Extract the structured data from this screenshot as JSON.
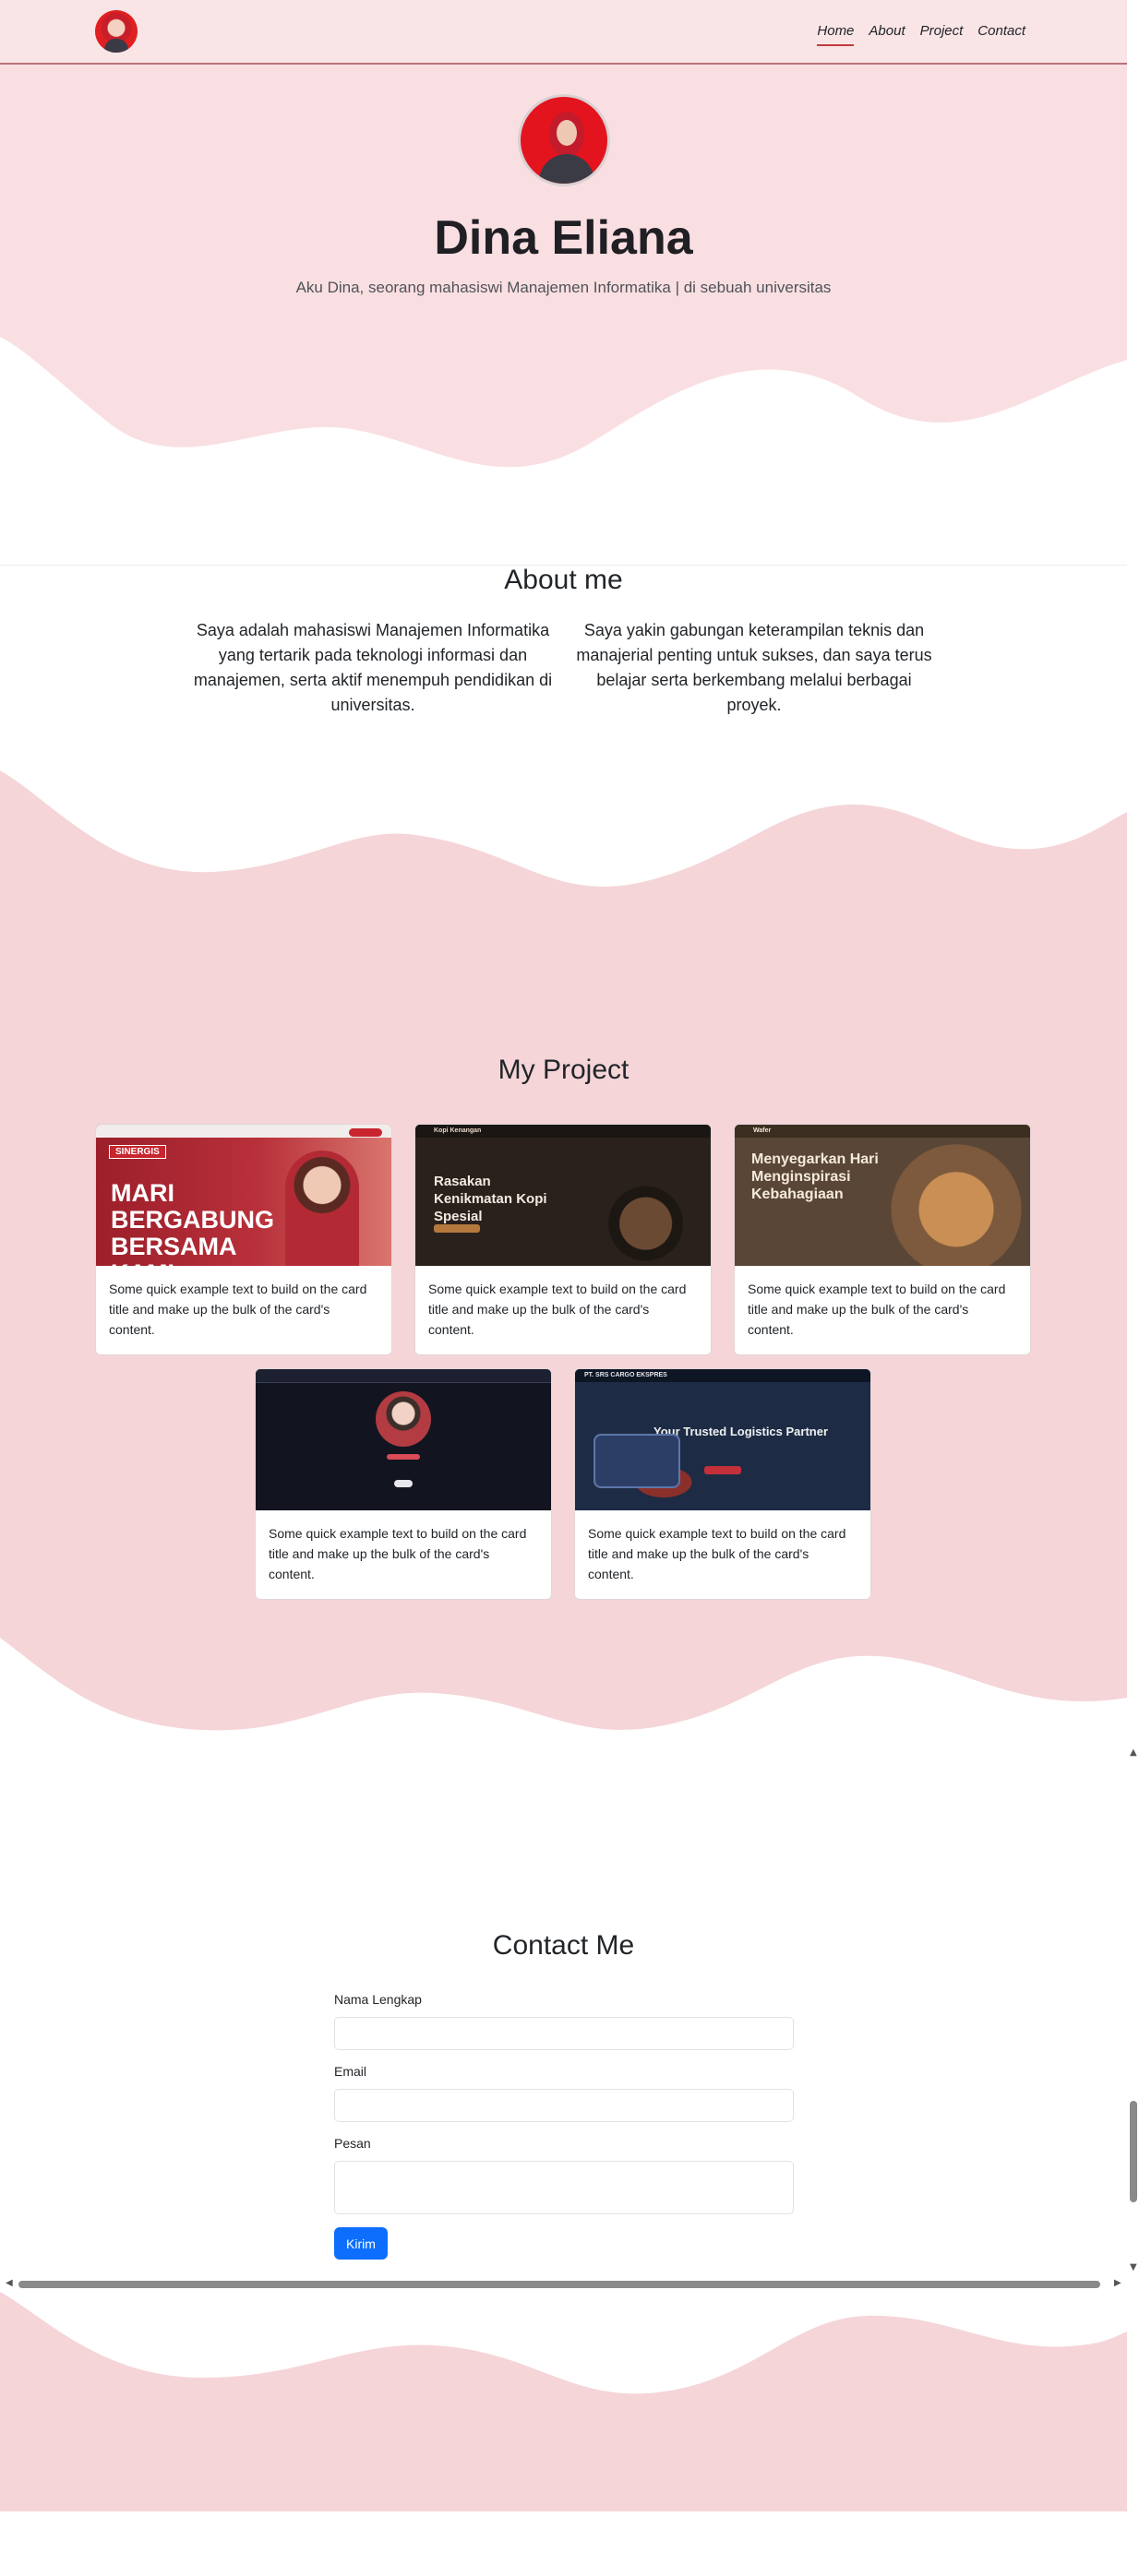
{
  "nav": {
    "links": [
      "Home",
      "About",
      "Project",
      "Contact"
    ],
    "active_index": 0
  },
  "hero": {
    "name": "Dina Eliana",
    "subtitle": "Aku Dina, seorang mahasiswi Manajemen Informatika | di sebuah universitas"
  },
  "about": {
    "title": "About me",
    "left_text": "Saya adalah mahasiswi Manajemen Informatika yang tertarik pada teknologi informasi dan manajemen, serta aktif menempuh pendidikan di universitas.",
    "right_text": "Saya yakin gabungan keterampilan teknis dan manajerial penting untuk sukses, dan saya terus belajar serta berkembang melalui berbagai proyek."
  },
  "projects": {
    "title": "My Project",
    "cards": [
      {
        "thumb_text": "MARI BERGABUNG BERSAMA KAMI",
        "thumb_badge": "SINERGIS",
        "text": "Some quick example text to build on the card title and make up the bulk of the card's content."
      },
      {
        "thumb_text": "Rasakan Kenikmatan Kopi Spesial",
        "thumb_badge": "Kopi Kenangan",
        "text": "Some quick example text to build on the card title and make up the bulk of the card's content."
      },
      {
        "thumb_text": "Menyegarkan Hari Menginspirasi Kebahagiaan",
        "thumb_badge": "Wafer",
        "text": "Some quick example text to build on the card title and make up the bulk of the card's content."
      },
      {
        "thumb_text": "",
        "thumb_badge": "",
        "text": "Some quick example text to build on the card title and make up the bulk of the card's content."
      },
      {
        "thumb_text": "Your Trusted Logistics Partner",
        "thumb_badge": "PT. SRS CARGO EKSPRES",
        "text": "Some quick example text to build on the card title and make up the bulk of the card's content."
      }
    ]
  },
  "contact": {
    "title": "Contact Me",
    "name_label": "Nama Lengkap",
    "email_label": "Email",
    "message_label": "Pesan",
    "submit_label": "Kirim"
  },
  "colors": {
    "hero_bg": "#fbe1e3",
    "wave_pink": "#f5d5d8",
    "accent": "#0d6efd",
    "nav_underline": "#c0393e"
  }
}
